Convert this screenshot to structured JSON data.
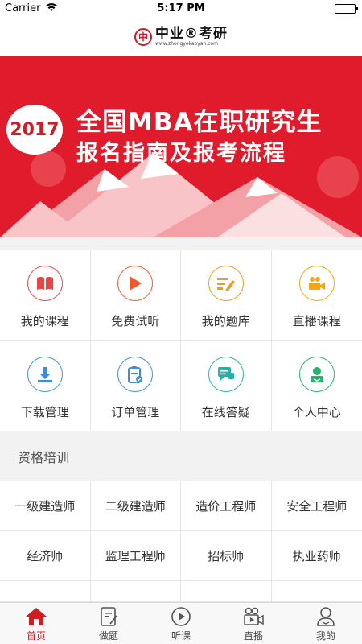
{
  "status_bar": {
    "carrier": "Carrier",
    "time": "5:17 PM",
    "battery_level": 1.0
  },
  "header": {
    "logo_mark": "中",
    "logo_text": "中业®考研",
    "logo_sub": "www.zhongyekaoyan.com"
  },
  "banner": {
    "year": "2017",
    "title_line1": "全国MBA在职研究生",
    "title_line2": "报名指南及报考流程",
    "background_color": "#e01b2b"
  },
  "menu": {
    "items": [
      {
        "label": "我的课程",
        "icon": "book-icon",
        "color": "#e84545"
      },
      {
        "label": "免费试听",
        "icon": "play-icon",
        "color": "#f0582b"
      },
      {
        "label": "我的题库",
        "icon": "edit-icon",
        "color": "#f39a1e"
      },
      {
        "label": "直播课程",
        "icon": "video-camera-icon",
        "color": "#f3a613"
      },
      {
        "label": "下载管理",
        "icon": "download-icon",
        "color": "#3c8de0"
      },
      {
        "label": "订单管理",
        "icon": "clipboard-icon",
        "color": "#3c8de0"
      },
      {
        "label": "在线答疑",
        "icon": "chat-icon",
        "color": "#22b3a7"
      },
      {
        "label": "个人中心",
        "icon": "user-icon",
        "color": "#28b36a"
      }
    ]
  },
  "section": {
    "title": "资格培训"
  },
  "qualifications": {
    "items": [
      "一级建造师",
      "二级建造师",
      "造价工程师",
      "安全工程师",
      "经济师",
      "监理工程师",
      "招标师",
      "执业药师",
      "",
      "",
      "",
      ""
    ]
  },
  "tabbar": {
    "items": [
      {
        "label": "首页",
        "icon": "home-icon",
        "active": true
      },
      {
        "label": "做题",
        "icon": "exercise-icon",
        "active": false
      },
      {
        "label": "听课",
        "icon": "play-circle-icon",
        "active": false
      },
      {
        "label": "直播",
        "icon": "live-icon",
        "active": false
      },
      {
        "label": "我的",
        "icon": "profile-icon",
        "active": false
      }
    ],
    "active_color": "#d21c24"
  }
}
